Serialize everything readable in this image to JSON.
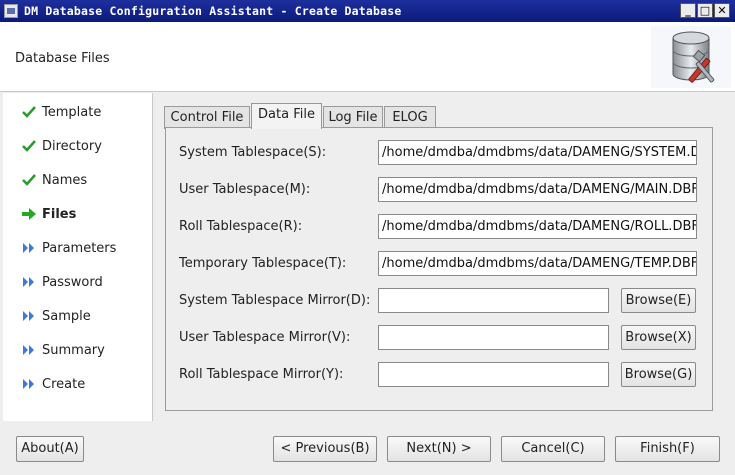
{
  "window": {
    "title": "DM Database Configuration Assistant - Create Database",
    "minimize": "_",
    "maximize": "□",
    "close": "✕"
  },
  "header": {
    "title": "Database Files",
    "logo_icon": "database-tools-icon"
  },
  "sidebar": {
    "steps": [
      {
        "label": "Template",
        "state": "done"
      },
      {
        "label": "Directory",
        "state": "done"
      },
      {
        "label": "Names",
        "state": "done"
      },
      {
        "label": "Files",
        "state": "current"
      },
      {
        "label": "Parameters",
        "state": "pending"
      },
      {
        "label": "Password",
        "state": "pending"
      },
      {
        "label": "Sample",
        "state": "pending"
      },
      {
        "label": "Summary",
        "state": "pending"
      },
      {
        "label": "Create",
        "state": "pending"
      }
    ]
  },
  "tabs": [
    {
      "label": "Control File",
      "active": false
    },
    {
      "label": "Data File",
      "active": true
    },
    {
      "label": "Log File",
      "active": false
    },
    {
      "label": "ELOG",
      "active": false
    }
  ],
  "form": {
    "system": {
      "label": "System Tablespace(S):",
      "value": "/home/dmdba/dmdbms/data/DAMENG/SYSTEM.DBF"
    },
    "user": {
      "label": "User Tablespace(M):",
      "value": "/home/dmdba/dmdbms/data/DAMENG/MAIN.DBF"
    },
    "roll": {
      "label": "Roll Tablespace(R):",
      "value": "/home/dmdba/dmdbms/data/DAMENG/ROLL.DBF"
    },
    "temp": {
      "label": "Temporary Tablespace(T):",
      "value": "/home/dmdba/dmdbms/data/DAMENG/TEMP.DBF"
    },
    "system_mirror": {
      "label": "System Tablespace Mirror(D):",
      "value": "",
      "browse": "Browse(E)"
    },
    "user_mirror": {
      "label": "User Tablespace Mirror(V):",
      "value": "",
      "browse": "Browse(X)"
    },
    "roll_mirror": {
      "label": "Roll Tablespace Mirror(Y):",
      "value": "",
      "browse": "Browse(G)"
    }
  },
  "footer": {
    "about": "About(A)",
    "previous": "< Previous(B)",
    "next": "Next(N) >",
    "cancel": "Cancel(C)",
    "finish": "Finish(F)"
  },
  "colors": {
    "titlebar": "#0b1a7a",
    "check": "#2a9a2a",
    "arrow_current": "#22aa22",
    "arrow_pending": "#3a7ad8"
  }
}
